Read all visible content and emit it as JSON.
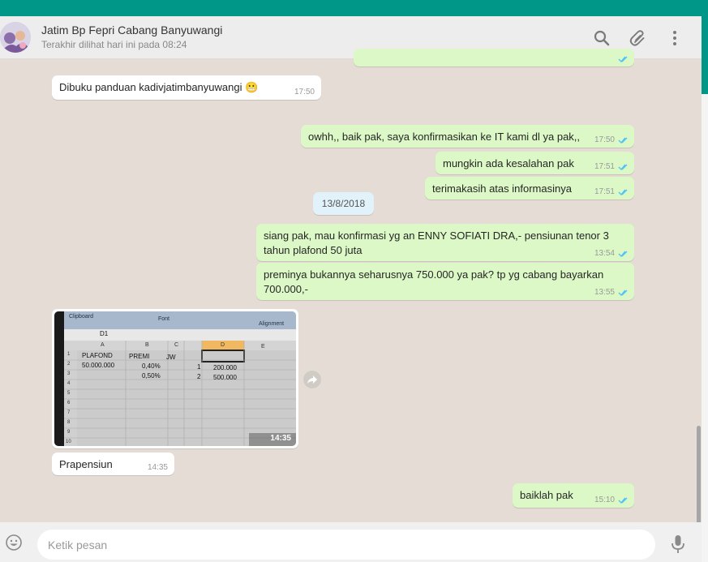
{
  "header": {
    "contact_name": "Jatim Bp Fepri Cabang Banyuwangi",
    "last_seen": "Terakhir dilihat hari ini pada 08:24",
    "icons": [
      "search-icon",
      "attach-icon",
      "menu-icon"
    ]
  },
  "messages": [
    {
      "text": "Dibuku panduan kadivjatimbanyuwangi 😬",
      "time": "17:50",
      "direction": "incoming"
    },
    {
      "text": "owhh,, baik pak, saya konfirmasikan ke IT kami dl ya pak,,",
      "time": "17:50",
      "direction": "outgoing",
      "status": "read"
    },
    {
      "text": "mungkin ada kesalahan pak",
      "time": "17:51",
      "direction": "outgoing",
      "status": "read"
    },
    {
      "text": "terimakasih atas informasinya",
      "time": "17:51",
      "direction": "outgoing",
      "status": "read"
    },
    {
      "text": "siang pak, mau konfirmasi yg an ENNY SOFIATI DRA,- pensiunan tenor 3 tahun plafond 50 juta",
      "time": "13:54",
      "direction": "outgoing",
      "status": "read"
    },
    {
      "text": "preminya bukannya seharusnya 750.000 ya pak? tp yg cabang bayarkan 700.000,-",
      "time": "13:55",
      "direction": "outgoing",
      "status": "read"
    },
    {
      "text": "Prapensiun",
      "time": "14:35",
      "direction": "incoming"
    },
    {
      "text": "baiklah pak",
      "time": "15:10",
      "direction": "outgoing",
      "status": "read"
    }
  ],
  "date_divider": "13/8/2018",
  "photo": {
    "time": "14:35",
    "spreadsheet": {
      "ribbon": [
        "Clipboard",
        "Font",
        "Alignment"
      ],
      "name_box": "D1",
      "columns": [
        "A",
        "B",
        "C",
        "D",
        "E"
      ],
      "row_numbers": [
        "1",
        "2",
        "3",
        "4",
        "5",
        "6",
        "7",
        "8",
        "9",
        "10"
      ],
      "cells": [
        [
          "PLAFOND",
          "PREMI",
          "JW",
          "",
          ""
        ],
        [
          "50.000.000",
          "0,40%",
          "1",
          "200.000",
          ""
        ],
        [
          "",
          "0,50%",
          "2",
          "500.000",
          ""
        ]
      ]
    }
  },
  "footer": {
    "placeholder": "Ketik pesan"
  },
  "colors": {
    "accent": "#009688",
    "outgoing_bubble": "#dcf8c6",
    "incoming_bubble": "#ffffff",
    "read_ticks": "#4fc3f7",
    "chat_background": "#e5ddd5"
  }
}
